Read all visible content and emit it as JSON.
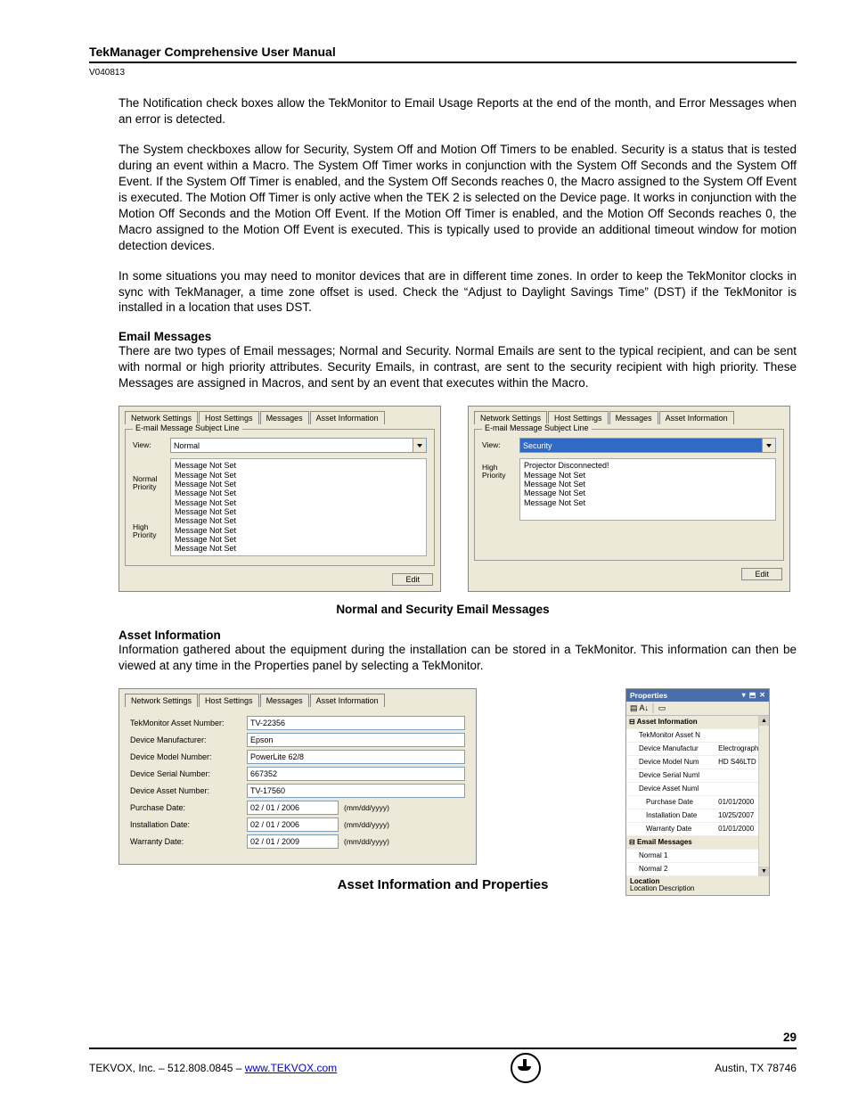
{
  "header": {
    "title": "TekManager Comprehensive User Manual",
    "version": "V040813"
  },
  "paragraphs": {
    "p1": "The Notification check boxes allow the TekMonitor to Email Usage Reports at the end of the month, and Error Messages when an error is detected.",
    "p2": "The System checkboxes allow for Security, System Off and Motion Off Timers to be enabled. Security is a status that is tested during an event within a Macro. The System Off Timer works in conjunction with the System Off Seconds and the System Off Event. If the System Off Timer is enabled, and the System Off Seconds reaches 0, the Macro assigned to the System Off Event is executed.  The Motion Off Timer is only active when the TEK 2 is selected on the Device page. It works in conjunction with the Motion Off Seconds and the Motion Off Event.  If the Motion Off Timer is enabled, and the Motion Off Seconds reaches 0, the Macro assigned to the Motion Off Event is executed.  This is typically used to provide an additional timeout window for motion detection devices.",
    "p3": "In some situations you may need to monitor devices that are in different time zones. In order to keep the TekMonitor clocks in sync with TekManager, a time zone offset is used. Check the “Adjust to Daylight Savings Time” (DST) if the TekMonitor is installed in a location that uses DST.",
    "email_heading": "Email Messages",
    "p4": "There are two types of Email messages; Normal and Security. Normal Emails are sent to the typical recipient, and can be sent with normal or high priority attributes. Security Emails, in contrast, are sent to the security recipient with high priority. These Messages are assigned in Macros, and sent by an event that executes within the Macro.",
    "asset_heading": "Asset Information",
    "p5": "Information gathered about the equipment during the installation can be stored in a TekMonitor. This information can then be viewed at any time in the Properties panel by selecting a TekMonitor."
  },
  "captions": {
    "email_caption": "Normal and Security Email Messages",
    "asset_caption": "Asset Information and Properties"
  },
  "tabs": {
    "network": "Network Settings",
    "host": "Host Settings",
    "messages": "Messages",
    "asset": "Asset Information"
  },
  "email_panel": {
    "fieldset_title": "E-mail Message Subject Line",
    "view_label": "View:",
    "view_normal": "Normal",
    "view_security": "Security",
    "normal_priority_label": "Normal\nPriority",
    "high_priority_label": "High\nPriority",
    "msg_not_set": "Message Not Set",
    "projector_disc": "Projector Disconnected!",
    "edit_btn": "Edit"
  },
  "asset_form": {
    "tekmonitor_num_lbl": "TekMonitor Asset Number:",
    "tekmonitor_num_val": "TV-22356",
    "manufacturer_lbl": "Device Manufacturer:",
    "manufacturer_val": "Epson",
    "model_lbl": "Device Model Number:",
    "model_val": "PowerLite 62/8",
    "serial_lbl": "Device Serial Number:",
    "serial_val": "667352",
    "dev_asset_lbl": "Device Asset Number:",
    "dev_asset_val": "TV-17560",
    "purchase_lbl": "Purchase Date:",
    "purchase_val": "02 / 01 / 2006",
    "install_lbl": "Installation Date:",
    "install_val": "02 / 01 / 2006",
    "warranty_lbl": "Warranty Date:",
    "warranty_val": "02 / 01 / 2009",
    "date_hint": "(mm/dd/yyyy)"
  },
  "props": {
    "title": "Properties",
    "cat_asset": "Asset Information",
    "tek_asset": "TekMonitor Asset N",
    "dev_manu_lbl": "Device Manufactur",
    "dev_manu_val": "Electrograph",
    "dev_model_lbl": "Device Model Num",
    "dev_model_val": "HD S46LTD",
    "dev_serial": "Device Serial Numl",
    "dev_asset": "Device Asset Numl",
    "purchase_lbl": "Purchase Date",
    "purchase_val": "01/01/2000",
    "install_lbl": "Installation Date",
    "install_val": "10/25/2007",
    "warranty_lbl": "Warranty Date",
    "warranty_val": "01/01/2000",
    "cat_email": "Email Messages",
    "normal1": "Normal 1",
    "normal2": "Normal 2",
    "footer1": "Location",
    "footer2": "Location Description"
  },
  "footer": {
    "page_num": "29",
    "left": "TEKVOX, Inc. – 512.808.0845 – ",
    "link": "www.TEKVOX.com",
    "right": "Austin, TX  78746"
  }
}
